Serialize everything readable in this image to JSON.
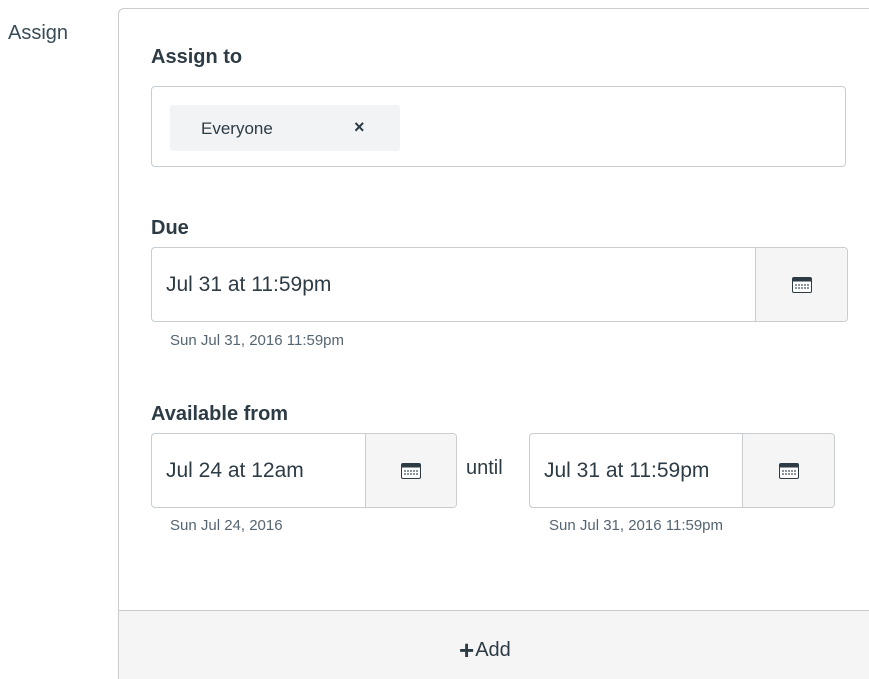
{
  "side_label": "Assign",
  "assign_to": {
    "label": "Assign to",
    "tokens": [
      {
        "label": "Everyone",
        "remove_glyph": "×"
      }
    ]
  },
  "due": {
    "label": "Due",
    "value": "Jul 31 at 11:59pm",
    "helper": "Sun Jul 31, 2016 11:59pm",
    "button_icon": "calendar-icon"
  },
  "available": {
    "label": "Available from",
    "from_value": "Jul 24 at 12am",
    "from_helper": "Sun Jul 24, 2016",
    "until_label": "until",
    "until_value": "Jul 31 at 11:59pm",
    "until_helper": "Sun Jul 31, 2016 11:59pm",
    "button_icon": "calendar-icon"
  },
  "add": {
    "icon": "+",
    "label": "Add"
  }
}
